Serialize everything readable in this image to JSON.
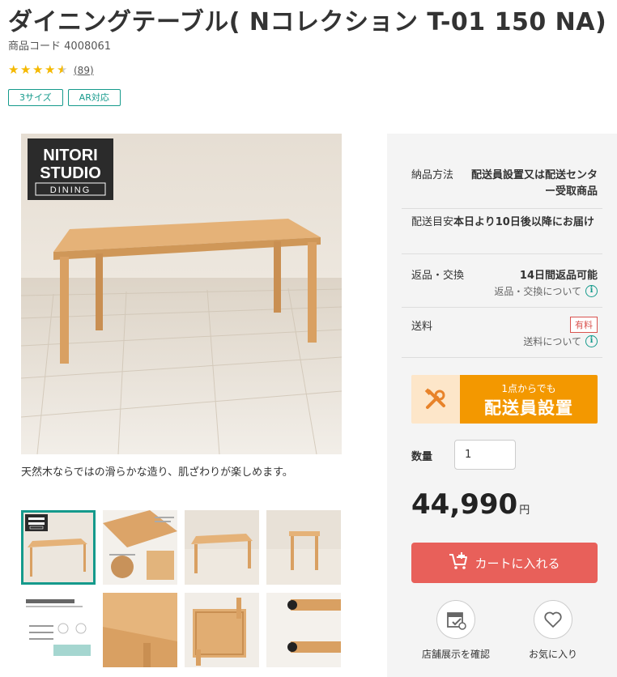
{
  "product": {
    "title": "ダイニングテーブル( Nコレクション T-01 150 NA)",
    "code_label": "商品コード",
    "code": "4008061",
    "rating": 4.5,
    "review_count": "(89)",
    "tags": [
      "3サイズ",
      "AR対応"
    ]
  },
  "gallery": {
    "brand_logo_text": [
      "NITORI",
      "STUDIO",
      "DINING"
    ],
    "caption": "天然木ならではの滑らかな造り、肌ざわりが楽しめます。"
  },
  "panel": {
    "delivery_method_label": "納品方法",
    "delivery_method_value": "配送員設置又は配送センター受取商品",
    "delivery_estimate_label": "配送目安",
    "delivery_estimate_value": "本日より10日後以降にお届け",
    "return_label": "返品・交換",
    "return_value": "14日間返品可能",
    "return_link": "返品・交換について",
    "shipping_label": "送料",
    "shipping_badge": "有料",
    "shipping_link": "送料について",
    "banner_small": "1点からでも",
    "banner_large": "配送員設置",
    "quantity_label": "数量",
    "quantity_value": "1",
    "price": "44,990",
    "currency": "円",
    "cart_button": "カートに入れる",
    "store_stock_label": "店舗展示を確認",
    "favorite_label": "お気に入り"
  },
  "colors": {
    "accent": "#159a8c",
    "cart": "#e8605a",
    "delivery": "#f39800",
    "star": "#f5b900"
  }
}
